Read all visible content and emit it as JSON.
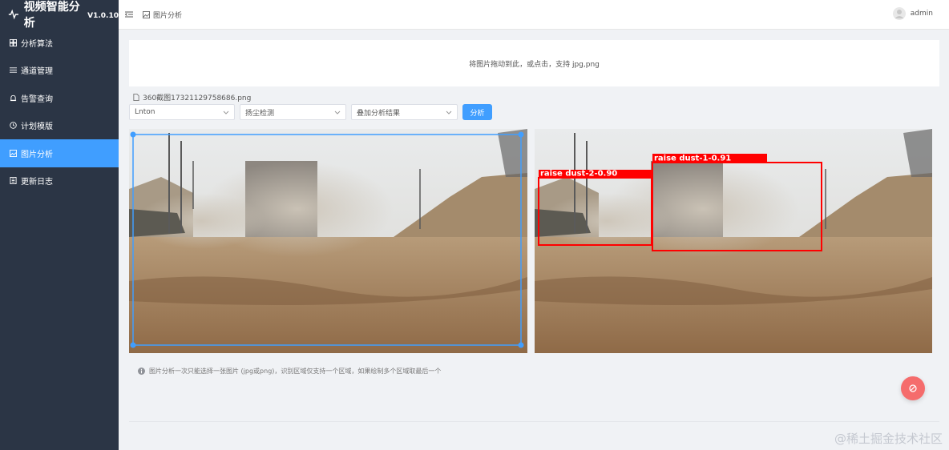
{
  "app": {
    "title": "视频智能分析",
    "version": "V1.0.10"
  },
  "sidebar": {
    "items": [
      {
        "label": "分析算法",
        "icon": "algorithm-icon",
        "active": false
      },
      {
        "label": "通道管理",
        "icon": "list-icon",
        "active": false
      },
      {
        "label": "告警查询",
        "icon": "bell-icon",
        "active": false
      },
      {
        "label": "计划模版",
        "icon": "clock-icon",
        "active": false
      },
      {
        "label": "图片分析",
        "icon": "image-icon",
        "active": true
      },
      {
        "label": "更新日志",
        "icon": "document-icon",
        "active": false
      }
    ]
  },
  "header": {
    "breadcrumb": "图片分析",
    "user": "admin"
  },
  "upload": {
    "hint": "将图片拖动到此，或点击，支持 jpg,png"
  },
  "file": {
    "name": "360截图17321129758686.png"
  },
  "filters": {
    "channel": "Lnton",
    "algorithm": "扬尘检测",
    "overlay": "叠加分析结果",
    "analyze_label": "分析"
  },
  "detections": [
    {
      "label": "raise dust-2-0.90"
    },
    {
      "label": "raise dust-1-0.91"
    }
  ],
  "tip": "图片分析一次只能选择一张图片 (jpg或png)，识别区域仅支持一个区域，如果绘制多个区域取最后一个",
  "watermark": "@稀土掘金技术社区",
  "colors": {
    "sidebar": "#2b3545",
    "accent": "#409eff",
    "detection": "#ff0000",
    "fab": "#f56c6c"
  }
}
